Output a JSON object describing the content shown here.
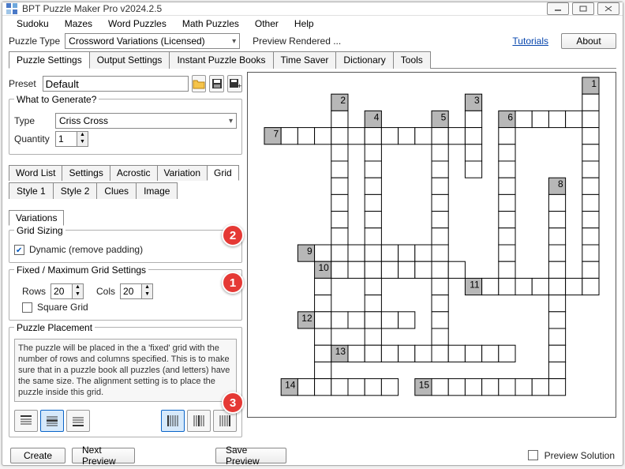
{
  "title": "BPT Puzzle Maker Pro v2024.2.5",
  "menubar": [
    "Sudoku",
    "Mazes",
    "Word Puzzles",
    "Math Puzzles",
    "Other",
    "Help"
  ],
  "row2": {
    "lbl": "Puzzle Type",
    "val": "Crossword Variations (Licensed)",
    "status": "Preview Rendered ...",
    "tutorials": "Tutorials",
    "about": "About"
  },
  "tabs_main": [
    "Puzzle Settings",
    "Output Settings",
    "Instant Puzzle Books",
    "Time Saver",
    "Dictionary",
    "Tools"
  ],
  "preset": {
    "lbl": "Preset",
    "val": "Default"
  },
  "gen": {
    "legend": "What to Generate?",
    "type_lbl": "Type",
    "type_val": "Criss Cross",
    "qty_lbl": "Quantity",
    "qty_val": "1"
  },
  "subtabs1": [
    "Word List",
    "Settings",
    "Acrostic",
    "Variation",
    "Grid"
  ],
  "subtabs2": [
    "Style 1",
    "Style 2",
    "Clues",
    "Image"
  ],
  "variations_tab": "Variations",
  "grid_sizing": {
    "legend": "Grid Sizing",
    "dyn": "Dynamic (remove padding)"
  },
  "fixed": {
    "legend": "Fixed / Maximum Grid Settings",
    "rows_lbl": "Rows",
    "rows_val": "20",
    "cols_lbl": "Cols",
    "cols_val": "20",
    "square": "Square Grid"
  },
  "placement": {
    "legend": "Puzzle Placement",
    "text": "The puzzle will be placed in the a 'fixed' grid with the number of rows and columns specified. This is to make sure that in a puzzle book all puzzles (and letters) have the same size. The alignment setting is to place the puzzle inside this grid."
  },
  "bottom": {
    "create": "Create",
    "next": "Next Preview",
    "save": "Save Preview",
    "sol": "Preview Solution"
  },
  "badges": [
    "1",
    "2",
    "3"
  ],
  "chart_data": {
    "type": "crossword-grid",
    "grid_cols": 20,
    "grid_rows": 20,
    "cells": [
      {
        "r": 0,
        "c": 19,
        "n": "1"
      },
      {
        "r": 1,
        "c": 4,
        "n": "2"
      },
      {
        "r": 1,
        "c": 12,
        "n": "3"
      },
      {
        "r": 1,
        "c": 19
      },
      {
        "r": 2,
        "c": 4
      },
      {
        "r": 2,
        "c": 6,
        "n": "4"
      },
      {
        "r": 2,
        "c": 10,
        "n": "5"
      },
      {
        "r": 2,
        "c": 12
      },
      {
        "r": 2,
        "c": 14,
        "n": "6"
      },
      {
        "r": 2,
        "c": 15
      },
      {
        "r": 2,
        "c": 16
      },
      {
        "r": 2,
        "c": 17
      },
      {
        "r": 2,
        "c": 18
      },
      {
        "r": 2,
        "c": 19
      },
      {
        "r": 3,
        "c": 0,
        "n": "7"
      },
      {
        "r": 3,
        "c": 1
      },
      {
        "r": 3,
        "c": 2
      },
      {
        "r": 3,
        "c": 3
      },
      {
        "r": 3,
        "c": 4
      },
      {
        "r": 3,
        "c": 5
      },
      {
        "r": 3,
        "c": 6
      },
      {
        "r": 3,
        "c": 7
      },
      {
        "r": 3,
        "c": 8
      },
      {
        "r": 3,
        "c": 9
      },
      {
        "r": 3,
        "c": 10
      },
      {
        "r": 3,
        "c": 11
      },
      {
        "r": 3,
        "c": 12
      },
      {
        "r": 3,
        "c": 14
      },
      {
        "r": 3,
        "c": 19
      },
      {
        "r": 4,
        "c": 4
      },
      {
        "r": 4,
        "c": 6
      },
      {
        "r": 4,
        "c": 10
      },
      {
        "r": 4,
        "c": 12
      },
      {
        "r": 4,
        "c": 14
      },
      {
        "r": 4,
        "c": 19
      },
      {
        "r": 5,
        "c": 4
      },
      {
        "r": 5,
        "c": 6
      },
      {
        "r": 5,
        "c": 10
      },
      {
        "r": 5,
        "c": 12
      },
      {
        "r": 5,
        "c": 14
      },
      {
        "r": 5,
        "c": 19
      },
      {
        "r": 6,
        "c": 4
      },
      {
        "r": 6,
        "c": 6
      },
      {
        "r": 6,
        "c": 10
      },
      {
        "r": 6,
        "c": 14
      },
      {
        "r": 6,
        "c": 17,
        "n": "8"
      },
      {
        "r": 6,
        "c": 19
      },
      {
        "r": 7,
        "c": 4
      },
      {
        "r": 7,
        "c": 6
      },
      {
        "r": 7,
        "c": 10
      },
      {
        "r": 7,
        "c": 14
      },
      {
        "r": 7,
        "c": 17
      },
      {
        "r": 7,
        "c": 19
      },
      {
        "r": 8,
        "c": 4
      },
      {
        "r": 8,
        "c": 6
      },
      {
        "r": 8,
        "c": 10
      },
      {
        "r": 8,
        "c": 14
      },
      {
        "r": 8,
        "c": 17
      },
      {
        "r": 8,
        "c": 19
      },
      {
        "r": 9,
        "c": 4
      },
      {
        "r": 9,
        "c": 6
      },
      {
        "r": 9,
        "c": 10
      },
      {
        "r": 9,
        "c": 14
      },
      {
        "r": 9,
        "c": 17
      },
      {
        "r": 9,
        "c": 19
      },
      {
        "r": 10,
        "c": 2,
        "n": "9"
      },
      {
        "r": 10,
        "c": 3
      },
      {
        "r": 10,
        "c": 4
      },
      {
        "r": 10,
        "c": 5
      },
      {
        "r": 10,
        "c": 6
      },
      {
        "r": 10,
        "c": 7
      },
      {
        "r": 10,
        "c": 8
      },
      {
        "r": 10,
        "c": 9
      },
      {
        "r": 10,
        "c": 10
      },
      {
        "r": 10,
        "c": 14
      },
      {
        "r": 10,
        "c": 17
      },
      {
        "r": 10,
        "c": 19
      },
      {
        "r": 11,
        "c": 3,
        "n": "10"
      },
      {
        "r": 11,
        "c": 4
      },
      {
        "r": 11,
        "c": 5
      },
      {
        "r": 11,
        "c": 6
      },
      {
        "r": 11,
        "c": 7
      },
      {
        "r": 11,
        "c": 8
      },
      {
        "r": 11,
        "c": 9
      },
      {
        "r": 11,
        "c": 10
      },
      {
        "r": 11,
        "c": 11
      },
      {
        "r": 11,
        "c": 14
      },
      {
        "r": 11,
        "c": 17
      },
      {
        "r": 11,
        "c": 19
      },
      {
        "r": 12,
        "c": 3
      },
      {
        "r": 12,
        "c": 6
      },
      {
        "r": 12,
        "c": 10
      },
      {
        "r": 12,
        "c": 12,
        "n": "11"
      },
      {
        "r": 12,
        "c": 13
      },
      {
        "r": 12,
        "c": 14
      },
      {
        "r": 12,
        "c": 15
      },
      {
        "r": 12,
        "c": 16
      },
      {
        "r": 12,
        "c": 17
      },
      {
        "r": 12,
        "c": 18
      },
      {
        "r": 12,
        "c": 19
      },
      {
        "r": 13,
        "c": 3
      },
      {
        "r": 13,
        "c": 6
      },
      {
        "r": 13,
        "c": 10
      },
      {
        "r": 13,
        "c": 17
      },
      {
        "r": 14,
        "c": 2,
        "n": "12"
      },
      {
        "r": 14,
        "c": 3
      },
      {
        "r": 14,
        "c": 4
      },
      {
        "r": 14,
        "c": 5
      },
      {
        "r": 14,
        "c": 6
      },
      {
        "r": 14,
        "c": 7
      },
      {
        "r": 14,
        "c": 8
      },
      {
        "r": 14,
        "c": 10
      },
      {
        "r": 14,
        "c": 17
      },
      {
        "r": 15,
        "c": 3
      },
      {
        "r": 15,
        "c": 6
      },
      {
        "r": 15,
        "c": 10
      },
      {
        "r": 15,
        "c": 17
      },
      {
        "r": 16,
        "c": 3
      },
      {
        "r": 16,
        "c": 4,
        "n": "13"
      },
      {
        "r": 16,
        "c": 5
      },
      {
        "r": 16,
        "c": 6
      },
      {
        "r": 16,
        "c": 7
      },
      {
        "r": 16,
        "c": 8
      },
      {
        "r": 16,
        "c": 9
      },
      {
        "r": 16,
        "c": 10
      },
      {
        "r": 16,
        "c": 11
      },
      {
        "r": 16,
        "c": 12
      },
      {
        "r": 16,
        "c": 13
      },
      {
        "r": 16,
        "c": 14
      },
      {
        "r": 16,
        "c": 17
      },
      {
        "r": 17,
        "c": 3
      },
      {
        "r": 17,
        "c": 17
      },
      {
        "r": 18,
        "c": 1,
        "n": "14"
      },
      {
        "r": 18,
        "c": 2
      },
      {
        "r": 18,
        "c": 3
      },
      {
        "r": 18,
        "c": 4
      },
      {
        "r": 18,
        "c": 5
      },
      {
        "r": 18,
        "c": 6
      },
      {
        "r": 18,
        "c": 7
      },
      {
        "r": 18,
        "c": 9,
        "n": "15"
      },
      {
        "r": 18,
        "c": 10
      },
      {
        "r": 18,
        "c": 11
      },
      {
        "r": 18,
        "c": 12
      },
      {
        "r": 18,
        "c": 13
      },
      {
        "r": 18,
        "c": 14
      },
      {
        "r": 18,
        "c": 15
      },
      {
        "r": 18,
        "c": 16
      },
      {
        "r": 18,
        "c": 17
      }
    ]
  }
}
